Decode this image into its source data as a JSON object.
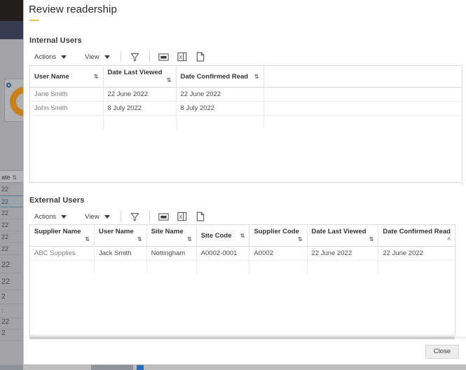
{
  "background": {
    "table_header": "ate",
    "sort_icon": "⇅",
    "rows": [
      "22",
      "22",
      "22",
      "22",
      "22",
      "22",
      "22",
      "22",
      "2",
      ":",
      "22",
      "2"
    ]
  },
  "dialog": {
    "title": "Review readership",
    "close_label": "Close"
  },
  "sections": [
    {
      "heading": "Internal Users",
      "toolbar": {
        "actions_label": "Actions",
        "view_label": "View",
        "filter_icon": "filter-icon",
        "csv_icon": "export-csv-icon",
        "excel_icon": "export-excel-icon",
        "file_icon": "export-file-icon"
      },
      "columns": [
        {
          "label": "User Name",
          "sort": "⇅"
        },
        {
          "label": "Date Last Viewed",
          "sort": "⇅"
        },
        {
          "label": "Date Confirmed Read",
          "sort": "⇅"
        },
        {
          "label": "",
          "sort": ""
        }
      ],
      "rows": [
        [
          "Jane Smith",
          "22 June 2022",
          "22 June 2022",
          ""
        ],
        [
          "John Smith",
          "8 July 2022",
          "8 July 2022",
          ""
        ]
      ]
    },
    {
      "heading": "External Users",
      "toolbar": {
        "actions_label": "Actions",
        "view_label": "View",
        "filter_icon": "filter-icon",
        "csv_icon": "export-csv-icon",
        "excel_icon": "export-excel-icon",
        "file_icon": "export-file-icon"
      },
      "columns": [
        {
          "label": "Supplier Name",
          "sort": "⇅"
        },
        {
          "label": "User Name",
          "sort": "⇅"
        },
        {
          "label": "Site Name",
          "sort": "⇅"
        },
        {
          "label": "Site Code",
          "sort": "⇅"
        },
        {
          "label": "Supplier Code",
          "sort": "⇅"
        },
        {
          "label": "Date Last Viewed",
          "sort": "⇅"
        },
        {
          "label": "Date Confirmed Read",
          "sort": "˄"
        }
      ],
      "rows": [
        [
          "ABC Supplies",
          "Jack Smith",
          "Nottingham",
          "A0002-0001",
          "A0002",
          "22 June 2022",
          "22 June 2022"
        ]
      ]
    }
  ],
  "colors": {
    "title_accent": "#e8c75a",
    "topbar": "#201f1d",
    "navbar": "#343a52",
    "donut": "#c8801c",
    "row_underline": "#4a7f85"
  }
}
